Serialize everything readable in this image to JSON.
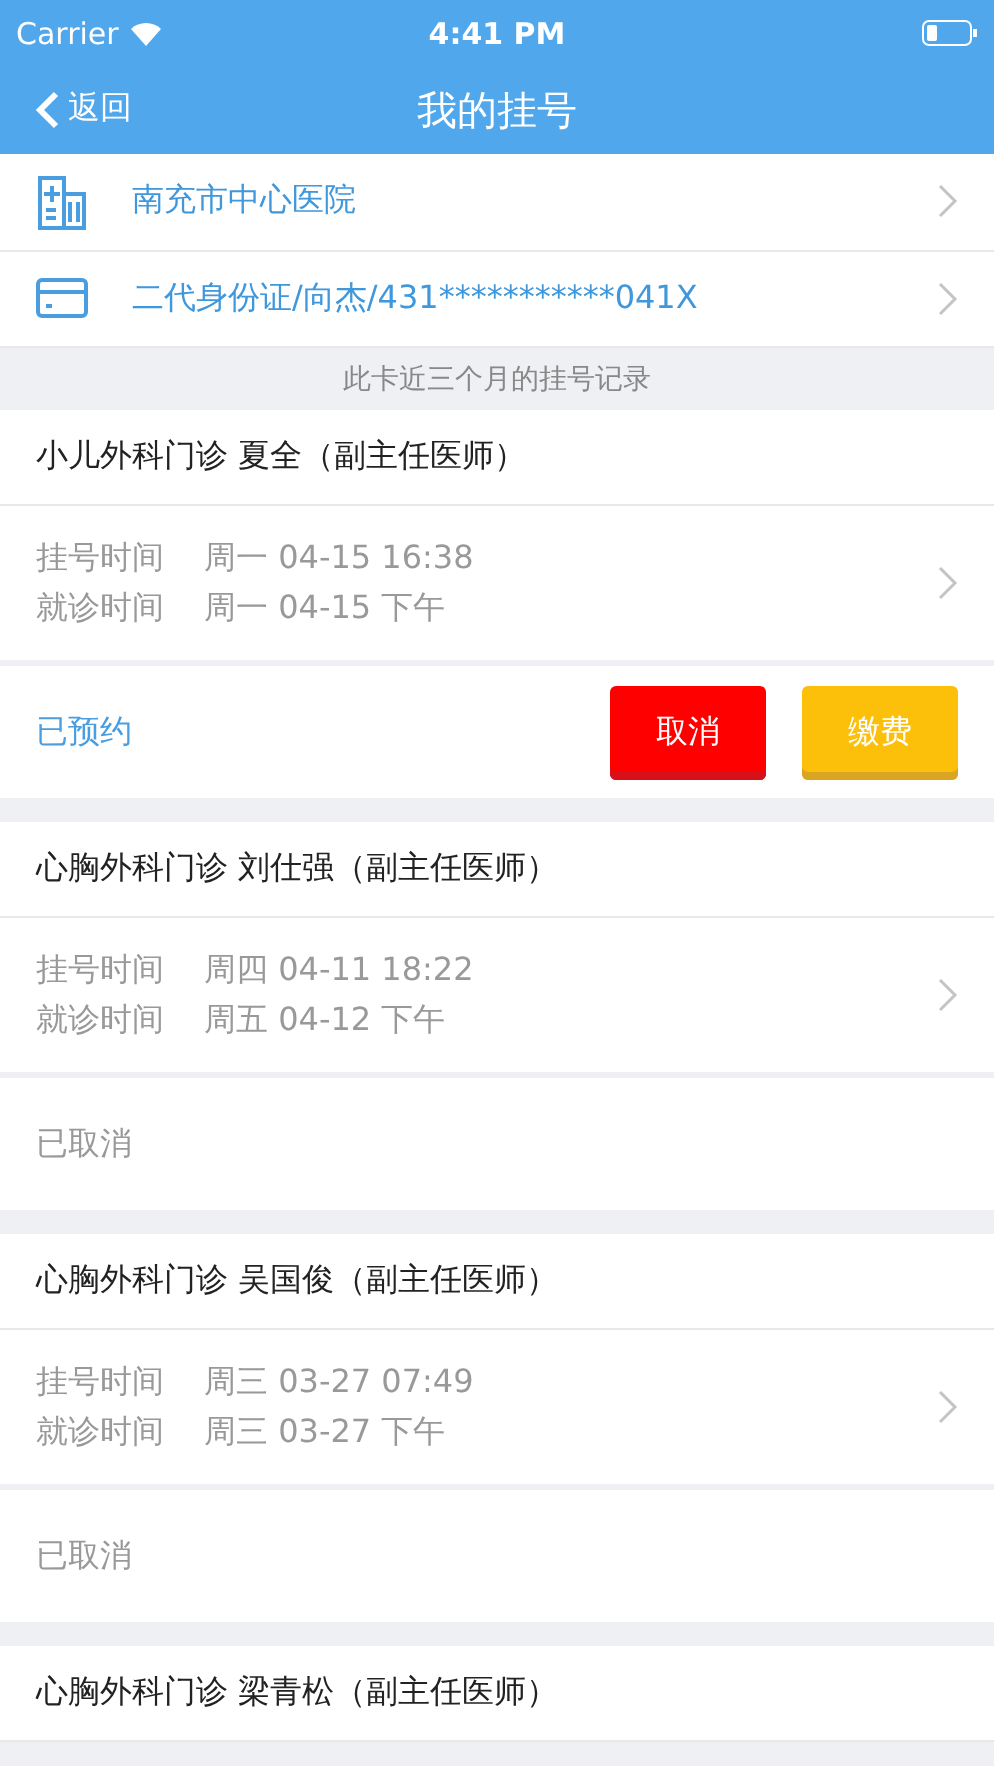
{
  "status_bar": {
    "carrier": "Carrier",
    "time": "4:41 PM"
  },
  "nav": {
    "back": "返回",
    "title": "我的挂号"
  },
  "info_rows": [
    {
      "kind": "hospital",
      "label": "南充市中心医院"
    },
    {
      "kind": "card",
      "label": "二代身份证/向杰/431***********041X"
    }
  ],
  "section_header": "此卡近三个月的挂号记录",
  "records": [
    {
      "title": "小儿外科门诊  夏全（副主任医师）",
      "times": [
        {
          "label": "挂号时间",
          "value": "周一 04-15 16:38"
        },
        {
          "label": "就诊时间",
          "value": "周一 04-15 下午"
        }
      ],
      "status": {
        "kind": "booked",
        "text": "已预约"
      },
      "actions": [
        {
          "kind": "cancel",
          "label": "取消"
        },
        {
          "kind": "pay",
          "label": "缴费"
        }
      ]
    },
    {
      "title": "心胸外科门诊  刘仕强（副主任医师）",
      "times": [
        {
          "label": "挂号时间",
          "value": "周四 04-11 18:22"
        },
        {
          "label": "就诊时间",
          "value": "周五 04-12 下午"
        }
      ],
      "status": {
        "kind": "cancelled",
        "text": "已取消"
      }
    },
    {
      "title": "心胸外科门诊  吴国俊（副主任医师）",
      "times": [
        {
          "label": "挂号时间",
          "value": "周三 03-27 07:49"
        },
        {
          "label": "就诊时间",
          "value": "周三 03-27 下午"
        }
      ],
      "status": {
        "kind": "cancelled",
        "text": "已取消"
      }
    },
    {
      "title": "心胸外科门诊  梁青松（副主任医师）"
    }
  ]
}
